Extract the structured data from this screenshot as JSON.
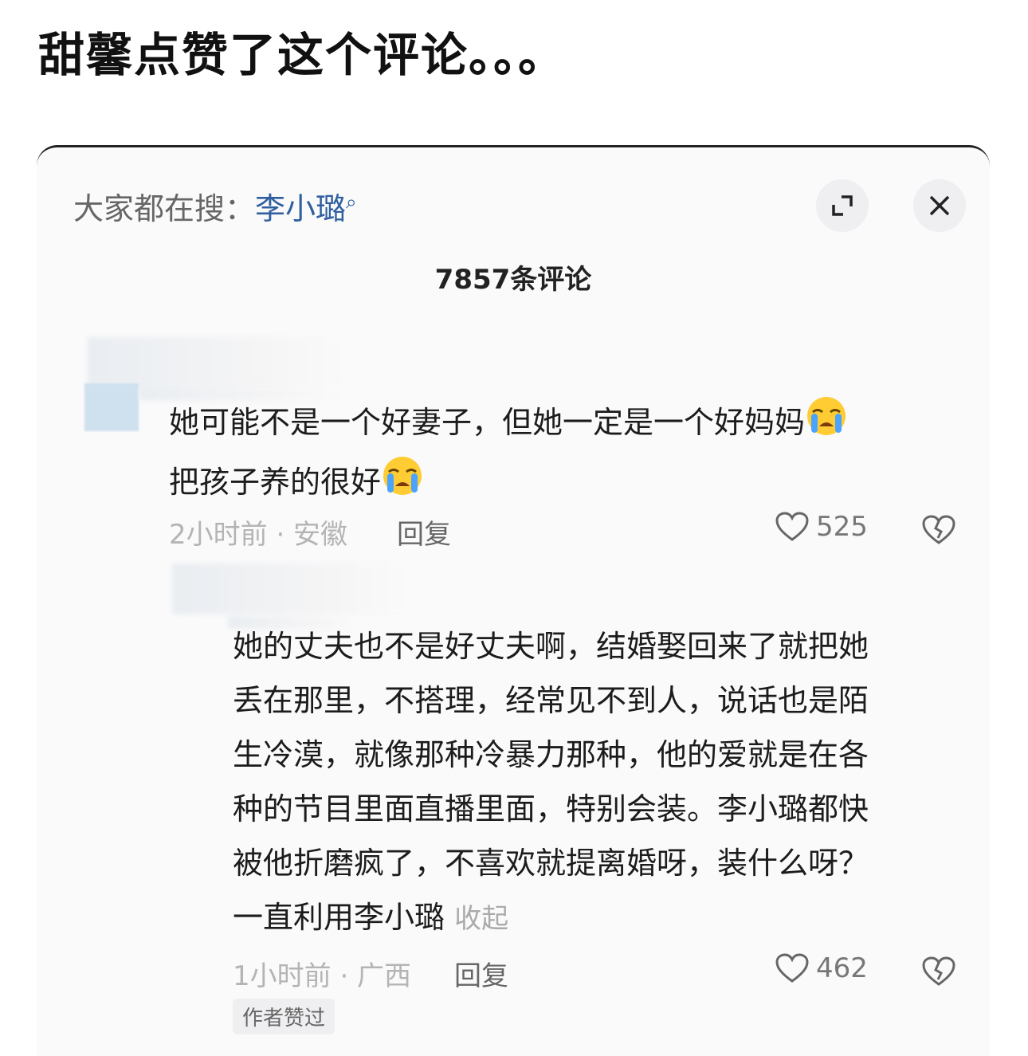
{
  "caption": "甜馨点赞了这个评论。。。",
  "header": {
    "search_label": "大家都在搜：",
    "search_keyword": "李小璐",
    "comment_count": "7857条评论"
  },
  "comments": [
    {
      "line1": "她可能不是一个好妻子，但她一定是一个好妈妈",
      "line2": "把孩子养的很好",
      "meta": "2小时前 · 安徽",
      "reply": "回复",
      "likes": "525",
      "emoji": "loudly-crying-face"
    },
    {
      "lines": [
        "她的丈夫也不是好丈夫啊，结婚娶回来了就把她",
        "丢在那里，不搭理，经常见不到人，说话也是陌",
        "生冷漠，就像那种冷暴力那种，他的爱就是在各",
        "种的节目里面直播里面，特别会装。李小璐都快",
        "被他折磨疯了，不喜欢就提离婚呀，装什么呀？",
        "一直利用李小璐"
      ],
      "collapse": "收起",
      "meta": "1小时前 · 广西",
      "reply": "回复",
      "likes": "462",
      "badge": "作者赞过"
    }
  ],
  "colors": {
    "keyword": "#2f5f9f",
    "panel": "#fafafb"
  }
}
